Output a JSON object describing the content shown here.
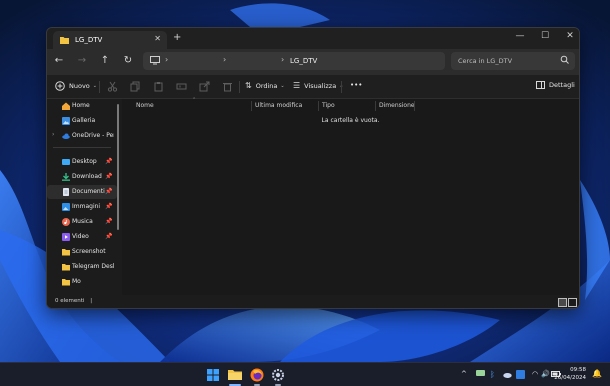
{
  "window": {
    "tab_title": "LG_DTV",
    "tab_close": "✕",
    "new_tab": "+",
    "controls": {
      "minimize": "—",
      "maximize": "☐",
      "close": "✕"
    }
  },
  "nav": {
    "back": "←",
    "forward": "→",
    "up": "↑",
    "refresh": "↻",
    "chevron": "›",
    "path": "LG_DTV",
    "search_placeholder": "Cerca in LG_DTV"
  },
  "toolbar": {
    "new_label": "Nuovo",
    "sort_label": "Ordina",
    "view_label": "Visualizza",
    "more_label": "•••",
    "details_label": "Dettagli",
    "dropdown_arrow": "⌄"
  },
  "sidebar": {
    "items": [
      {
        "label": "Home",
        "icon": "home-icon",
        "pinned": false
      },
      {
        "label": "Galleria",
        "icon": "gallery-icon",
        "pinned": false
      },
      {
        "label": "OneDrive - Perso",
        "icon": "onedrive-icon",
        "pinned": false
      },
      {
        "label": "Desktop",
        "icon": "desktop-icon",
        "pinned": true
      },
      {
        "label": "Download",
        "icon": "download-icon",
        "pinned": true
      },
      {
        "label": "Documenti",
        "icon": "documents-icon",
        "pinned": true
      },
      {
        "label": "Immagini",
        "icon": "pictures-icon",
        "pinned": true
      },
      {
        "label": "Musica",
        "icon": "music-icon",
        "pinned": true
      },
      {
        "label": "Video",
        "icon": "video-icon",
        "pinned": true
      },
      {
        "label": "Screenshot",
        "icon": "folder-icon",
        "pinned": false
      },
      {
        "label": "Telegram Deskto",
        "icon": "folder-icon",
        "pinned": false
      },
      {
        "label": "Mo",
        "icon": "folder-icon",
        "pinned": false
      }
    ],
    "pin_glyph": "📌",
    "expand_glyph": "›"
  },
  "columns": {
    "name": "Nome",
    "modified": "Ultima modifica",
    "type": "Tipo",
    "size": "Dimensione"
  },
  "content": {
    "empty_message": "La cartella è vuota."
  },
  "status": {
    "items_count": "0 elementi",
    "separator": "|"
  },
  "taskbar": {
    "time": "09:58",
    "date": "26/04/2024",
    "tray_chevron": "^"
  },
  "colors": {
    "accent_blue": "#2f7de1",
    "folder_yellow": "#f3c443",
    "window_bg": "#1c1c1c"
  }
}
